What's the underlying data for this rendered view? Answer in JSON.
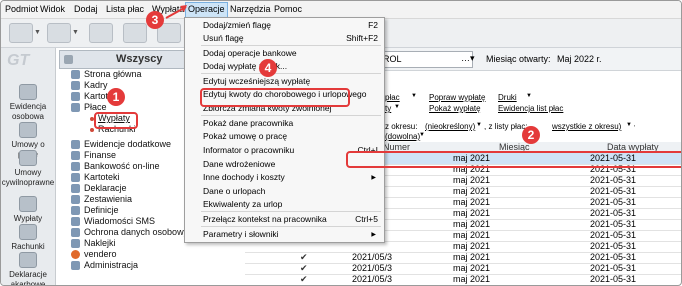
{
  "menubar": [
    "Podmiot",
    "Widok",
    "Dodaj",
    "Lista płac",
    "Wypłata",
    "Operacje",
    "Narzędzia",
    "Pomoc"
  ],
  "left_panel": {
    "logo_text": "GT",
    "items": [
      "Ewidencja osobowa",
      "Umowy o pracę",
      "Umowy cywilnoprawne",
      "Wypłaty",
      "Rachunki",
      "Deklaracje akarbowe"
    ]
  },
  "tree": {
    "header": "Wszyscy",
    "items": [
      "Strona główna",
      "Kadry",
      "Kartoteki",
      "Płace",
      "Wypłaty",
      "Rachunki",
      "Ewidencje dodatkowe",
      "Finanse",
      "Bankowość on-line",
      "Kartoteki",
      "Deklaracje",
      "Zestawienia",
      "Definicje",
      "Wiadomości SMS",
      "Ochrona danych osobowych",
      "Naklejki",
      "vendero",
      "Administracja"
    ]
  },
  "content": {
    "employee": "JK KAROL",
    "month_label": "Miesiąc otwarty:",
    "month_value": "Maj 2022 r.",
    "actions_row1": [
      "płac",
      "Popraw wypłatę",
      "Druki"
    ],
    "actions_row2": [
      "ty",
      "Pokaż wypłatę",
      "Ewidencja list płac"
    ],
    "filter": {
      "prefix": "z okresu:",
      "period": "(nieokreślony)",
      "list_prefix": ", z listy płac:",
      "list_value": "wszystkie z okresu)",
      "extra": "(dowolna)"
    },
    "columns": [
      "Numer",
      "Miesiąc",
      "Data wypłaty"
    ],
    "rows": [
      {
        "numer": "2",
        "miesiac": "maj 2021",
        "data": "2021-05-31",
        "check": false,
        "selected": true
      },
      {
        "numer": "",
        "miesiac": "maj 2021",
        "data": "2021-05-31",
        "check": false
      },
      {
        "numer": "",
        "miesiac": "maj 2021",
        "data": "2021-05-31",
        "check": false
      },
      {
        "numer": "",
        "miesiac": "maj 2021",
        "data": "2021-05-31",
        "check": false
      },
      {
        "numer": "",
        "miesiac": "maj 2021",
        "data": "2021-05-31",
        "check": false
      },
      {
        "numer": "",
        "miesiac": "maj 2021",
        "data": "2021-05-31",
        "check": false
      },
      {
        "numer": "",
        "miesiac": "maj 2021",
        "data": "2021-05-31",
        "check": false
      },
      {
        "numer": "",
        "miesiac": "maj 2021",
        "data": "2021-05-31",
        "check": false
      },
      {
        "numer": "",
        "miesiac": "maj 2021",
        "data": "2021-05-31",
        "check": false
      },
      {
        "numer": "2021/05/3",
        "miesiac": "maj 2021",
        "data": "2021-05-31",
        "check": true
      },
      {
        "numer": "2021/05/3",
        "miesiac": "maj 2021",
        "data": "2021-05-31",
        "check": true
      },
      {
        "numer": "2021/05/3",
        "miesiac": "maj 2021",
        "data": "2021-05-31",
        "check": true
      },
      {
        "numer": "2021/05/3",
        "miesiac": "maj 2021",
        "data": "2021-05-31",
        "check": true
      }
    ]
  },
  "dropdown": {
    "items": [
      {
        "label": "Dodaj/zmień flagę",
        "shortcut": "F2"
      },
      {
        "label": "Usuń flagę",
        "shortcut": "Shift+F2"
      },
      {
        "label": "Dodaj operacje bankowe",
        "shortcut": ""
      },
      {
        "label": "Dodaj wypłatę z wyk...",
        "shortcut": ""
      },
      {
        "label": "Edytuj wcześniejszą wypłatę",
        "shortcut": ""
      },
      {
        "label": "Edytuj kwoty do chorobowego i urlopowego",
        "shortcut": ""
      },
      {
        "label": "Zbiorcza zmiana kwoty zwolnionej",
        "shortcut": ""
      },
      {
        "label": "Pokaż dane pracownika",
        "shortcut": ""
      },
      {
        "label": "Pokaż umowę o pracę",
        "shortcut": ""
      },
      {
        "label": "Informator o pracowniku",
        "shortcut": "Ctrl+I"
      },
      {
        "label": "Dane wdrożeniowe",
        "shortcut": ""
      },
      {
        "label": "Inne dochody i koszty",
        "shortcut": ""
      },
      {
        "label": "Dane o urlopach",
        "shortcut": ""
      },
      {
        "label": "Ekwiwalenty za urlop",
        "shortcut": ""
      },
      {
        "label": "Przełącz kontekst na pracownika",
        "shortcut": "Ctrl+5"
      },
      {
        "label": "Parametry i słowniki",
        "shortcut": ""
      }
    ]
  },
  "annotations": [
    "1",
    "2",
    "3",
    "4"
  ],
  "colors": {
    "annotation": "#e33a3a",
    "selection": "#cfe3f6",
    "menu_active": "#cde4f7"
  }
}
